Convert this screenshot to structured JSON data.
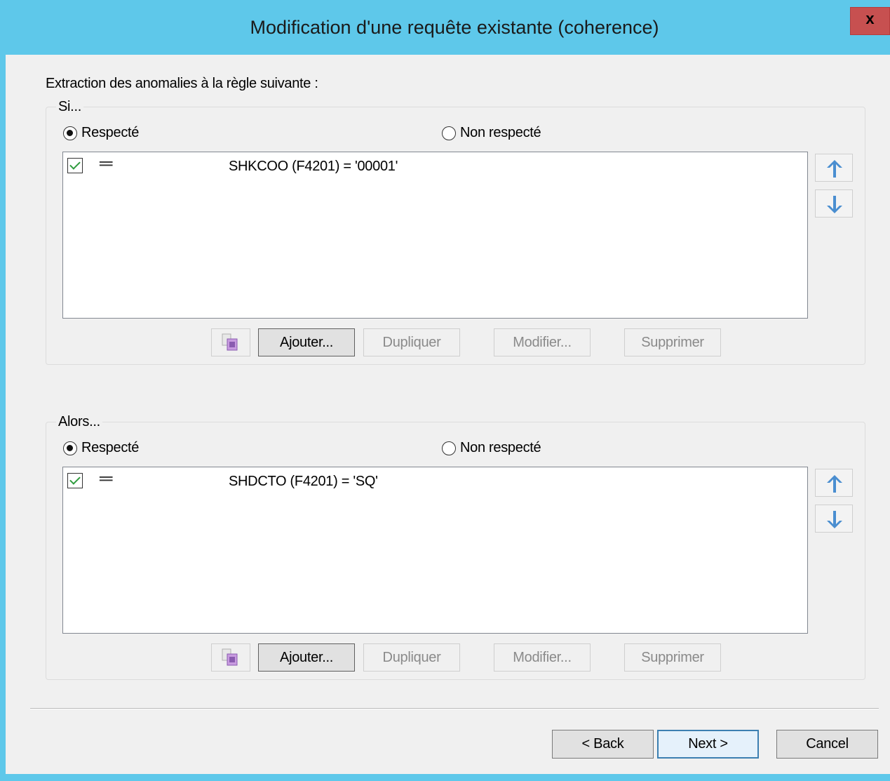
{
  "window": {
    "title": "Modification d'une requête existante (coherence)",
    "close_label": "x"
  },
  "intro": "Extraction des anomalies à la règle suivante :",
  "if_group": {
    "title": "Si...",
    "radio_respected": "Respecté",
    "radio_not_respected": "Non respecté",
    "selected": "Respecté",
    "rows": [
      {
        "checked": true,
        "operator_icon": "equals-icon",
        "text": "SHKCOO (F4201) = '00001'"
      }
    ],
    "buttons": {
      "add": "Ajouter...",
      "duplicate": "Dupliquer",
      "modify": "Modifier...",
      "delete": "Supprimer"
    }
  },
  "then_group": {
    "title": "Alors...",
    "radio_respected": "Respecté",
    "radio_not_respected": "Non respecté",
    "selected": "Respecté",
    "rows": [
      {
        "checked": true,
        "operator_icon": "equals-icon",
        "text": "SHDCTO (F4201) = 'SQ'"
      }
    ],
    "buttons": {
      "add": "Ajouter...",
      "duplicate": "Dupliquer",
      "modify": "Modifier...",
      "delete": "Supprimer"
    }
  },
  "footer": {
    "back": "< Back",
    "next": "Next >",
    "cancel": "Cancel"
  },
  "colors": {
    "titlebar": "#5ec8ea",
    "close": "#c75050",
    "arrow": "#4a8ed0"
  }
}
